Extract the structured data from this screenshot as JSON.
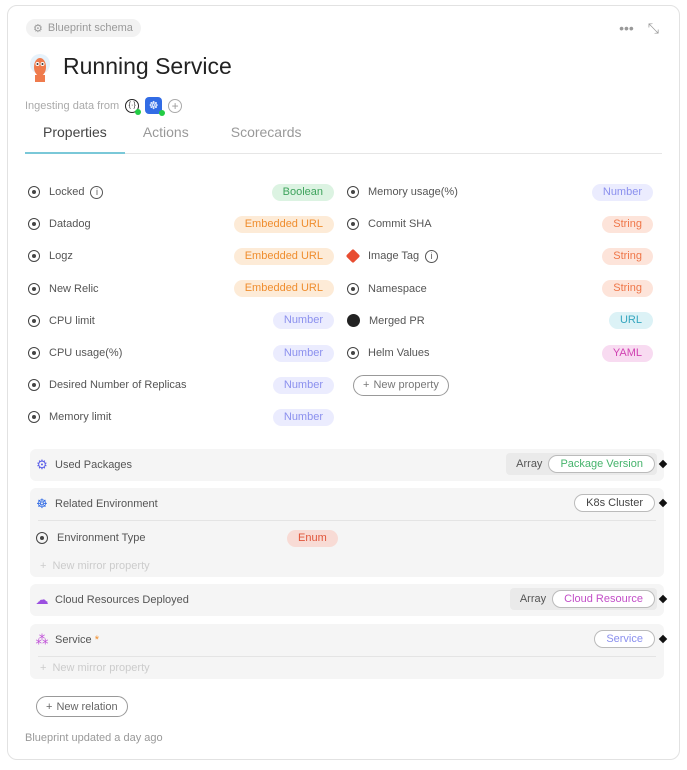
{
  "header": {
    "chip": "Blueprint schema",
    "title": "Running Service",
    "ingest_label": "Ingesting data from",
    "more_icon": "ellipsis-icon",
    "collapse_icon": "collapse-icon"
  },
  "tabs": [
    {
      "label": "Properties",
      "active": true
    },
    {
      "label": "Actions"
    },
    {
      "label": "Scorecards"
    }
  ],
  "properties_left": [
    {
      "name": "Locked",
      "type": "Boolean",
      "info": true
    },
    {
      "name": "Datadog",
      "type": "Embedded URL"
    },
    {
      "name": "Logz",
      "type": "Embedded URL"
    },
    {
      "name": "New Relic",
      "type": "Embedded URL"
    },
    {
      "name": "CPU limit",
      "type": "Number"
    },
    {
      "name": "CPU usage(%)",
      "type": "Number"
    },
    {
      "name": "Desired Number of Replicas",
      "type": "Number"
    },
    {
      "name": "Memory limit",
      "type": "Number"
    }
  ],
  "properties_right": [
    {
      "name": "Memory usage(%)",
      "type": "Number"
    },
    {
      "name": "Commit SHA",
      "type": "String"
    },
    {
      "name": "Image Tag",
      "type": "String",
      "info": true,
      "icon": "git-icon"
    },
    {
      "name": "Namespace",
      "type": "String"
    },
    {
      "name": "Merged PR",
      "type": "URL",
      "icon": "github-icon"
    },
    {
      "name": "Helm Values",
      "type": "YAML"
    }
  ],
  "new_property": "New property",
  "type_colors": {
    "Boolean": [
      "#dcf3e2",
      "#3ea35c"
    ],
    "Embedded URL": [
      "#fdebd7",
      "#ef8d2e"
    ],
    "Number": [
      "#ebecfe",
      "#8b90ee"
    ],
    "String": [
      "#fde4da",
      "#ef7648"
    ],
    "URL": [
      "#dcf2f6",
      "#35a6bf"
    ],
    "YAML": [
      "#f8dbf1",
      "#d042b2"
    ],
    "Enum": [
      "#f8dbd5",
      "#e0553a"
    ]
  },
  "relations": [
    {
      "name": "Used Packages",
      "array_label": "Array",
      "target": "Package Version",
      "target_color": "#45b36b"
    },
    {
      "name": "Related Environment",
      "target": "K8s Cluster",
      "target_color": "#444",
      "mirror": {
        "name": "Environment Type",
        "type": "Enum"
      },
      "new_mirror": "New mirror property"
    },
    {
      "name": "Cloud Resources Deployed",
      "array_label": "Array",
      "target": "Cloud Resource",
      "target_color": "#c34fc8"
    },
    {
      "name": "Service",
      "required": "*",
      "target": "Service",
      "target_color": "#8b90ee",
      "new_mirror": "New mirror property"
    }
  ],
  "new_relation": "New relation",
  "footer": "Blueprint updated a day ago"
}
